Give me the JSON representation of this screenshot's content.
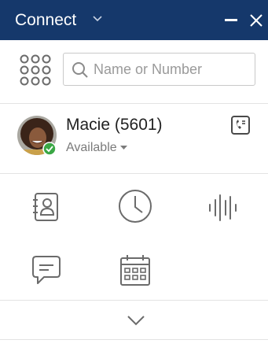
{
  "window": {
    "title": "Connect",
    "colors": {
      "titlebar": "#15386b",
      "icon": "#6b6b6b",
      "presence_available": "#3aa745"
    }
  },
  "toolbar": {
    "menu_icon": "apps-grid-icon",
    "search": {
      "placeholder": "Name or Number",
      "value": "",
      "icon": "search-icon"
    }
  },
  "profile": {
    "name": "Macie (5601)",
    "status": "Available",
    "status_icon": "check-badge-icon",
    "action_icon": "voicemail-phone-icon"
  },
  "apps": [
    {
      "name": "contacts",
      "icon": "contacts-book-icon"
    },
    {
      "name": "history",
      "icon": "clock-icon"
    },
    {
      "name": "voice",
      "icon": "audio-waveform-icon"
    },
    {
      "name": "chat",
      "icon": "chat-bubble-icon"
    },
    {
      "name": "calendar",
      "icon": "calendar-icon"
    }
  ],
  "footer": {
    "expand_icon": "chevron-down-icon"
  }
}
